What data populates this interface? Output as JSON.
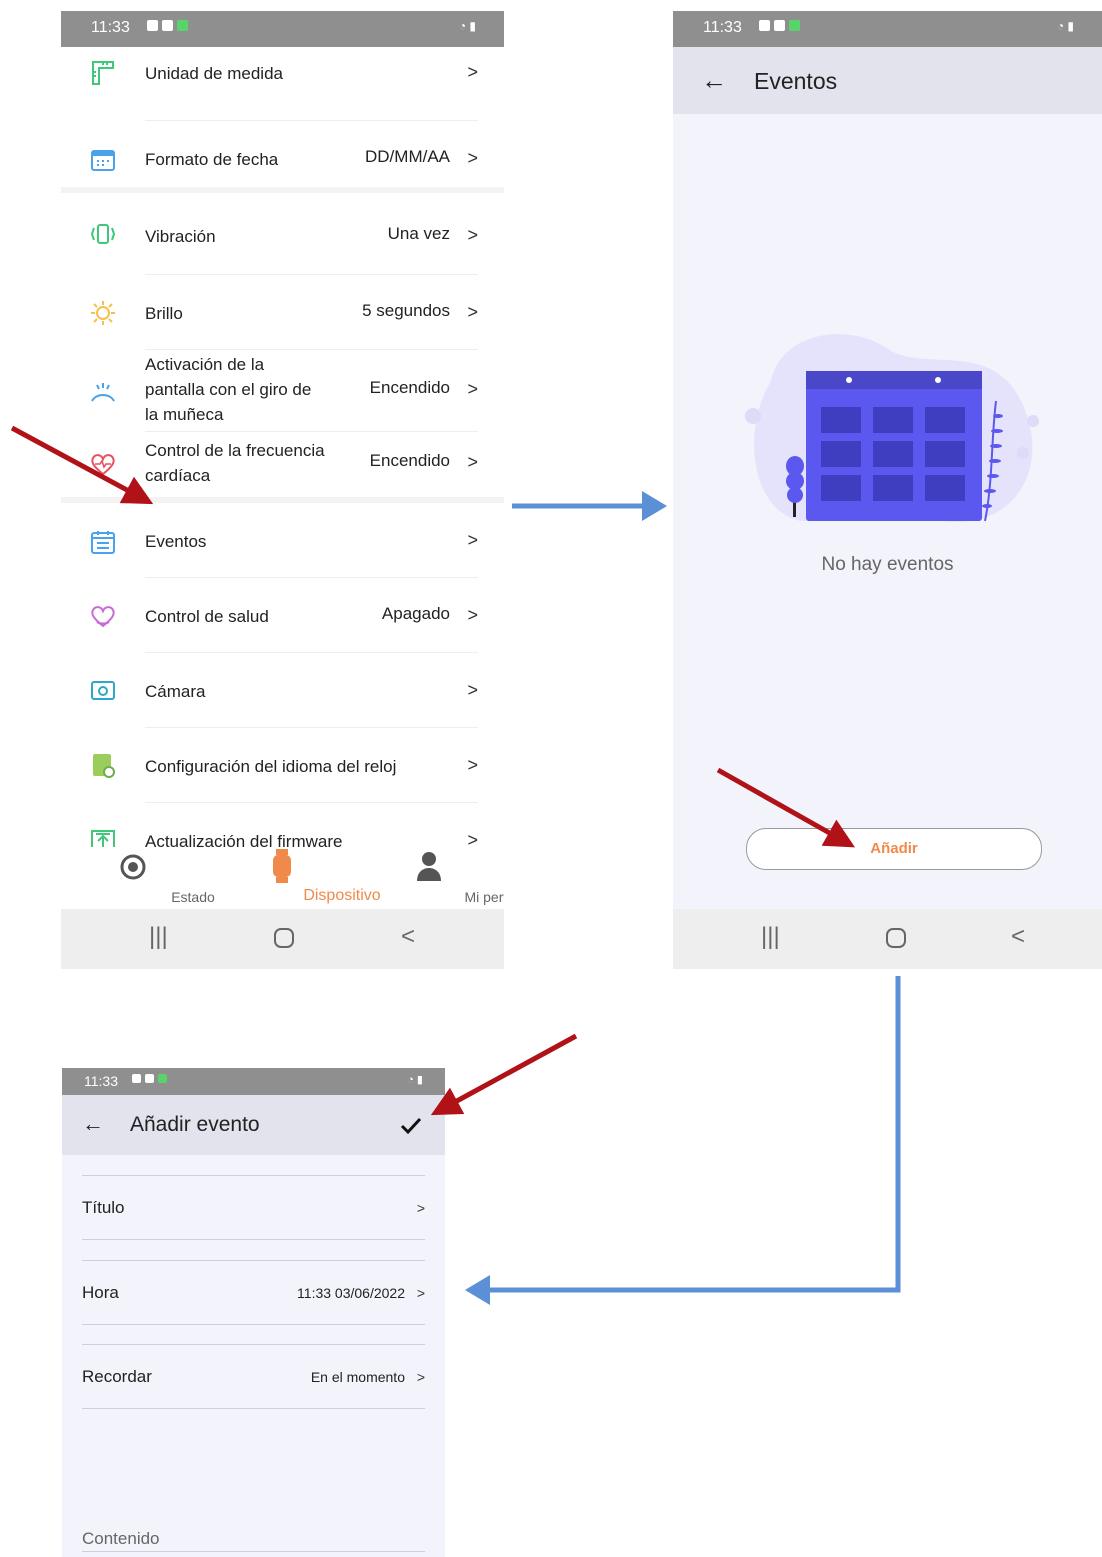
{
  "status": {
    "time": "11:33"
  },
  "screen1": {
    "rows": [
      {
        "label": "Unidad de medida",
        "value": ""
      },
      {
        "label": "Formato de fecha",
        "value": "DD/MM/AA"
      },
      {
        "label": "Vibración",
        "value": "Una vez"
      },
      {
        "label": "Brillo",
        "value": "5 segundos"
      },
      {
        "label_lines": [
          "Activación de la",
          "pantalla con el giro de",
          "la muñeca"
        ],
        "value": "Encendido"
      },
      {
        "label_lines": [
          "Control de la frecuencia",
          "cardíaca"
        ],
        "value": "Encendido"
      },
      {
        "label": "Eventos",
        "value": ""
      },
      {
        "label": "Control de salud",
        "value": "Apagado"
      },
      {
        "label": "Cámara",
        "value": ""
      },
      {
        "label": "Configuración del idioma del reloj",
        "value": ""
      },
      {
        "label": "Actualización del firmware",
        "value": ""
      }
    ],
    "nav": [
      {
        "label": "Estado"
      },
      {
        "label": "Dispositivo"
      },
      {
        "label": "Mi perfil"
      }
    ],
    "chevron": ">"
  },
  "screen2": {
    "title": "Eventos",
    "empty_text": "No hay eventos",
    "add_label": "Añadir"
  },
  "screen3": {
    "title": "Añadir evento",
    "fields": [
      {
        "label": "Título",
        "value": ""
      },
      {
        "label": "Hora",
        "value": "11:33 03/06/2022"
      },
      {
        "label": "Recordar",
        "value": "En el momento"
      }
    ],
    "content_placeholder": "Contenido"
  },
  "colors": {
    "accent": "#f08a4a",
    "arrow_red": "#b11218",
    "arrow_blue": "#5b8fd6",
    "calendar": "#5a58ee"
  }
}
